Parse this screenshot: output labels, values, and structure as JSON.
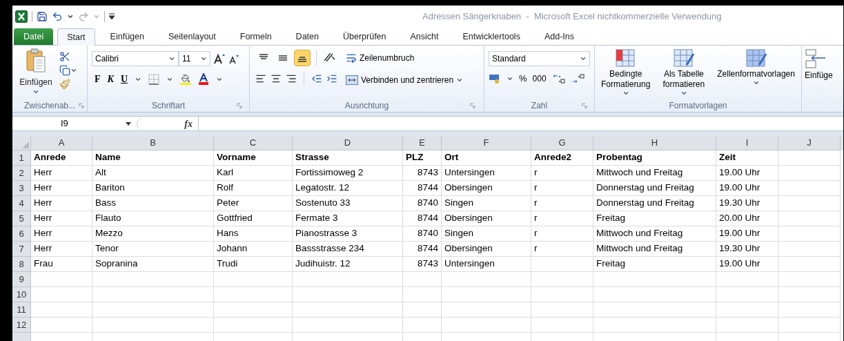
{
  "window": {
    "title": "Adressen Sängerknaben  -  Microsoft Excel nichtkommerzielle Verwendung"
  },
  "tabs": [
    {
      "label": "Datei",
      "kind": "file",
      "selected": false
    },
    {
      "label": "Start",
      "kind": "tab",
      "selected": true
    },
    {
      "label": "Einfügen",
      "kind": "tab",
      "selected": false
    },
    {
      "label": "Seitenlayout",
      "kind": "tab",
      "selected": false
    },
    {
      "label": "Formeln",
      "kind": "tab",
      "selected": false
    },
    {
      "label": "Daten",
      "kind": "tab",
      "selected": false
    },
    {
      "label": "Überprüfen",
      "kind": "tab",
      "selected": false
    },
    {
      "label": "Ansicht",
      "kind": "tab",
      "selected": false
    },
    {
      "label": "Entwicklertools",
      "kind": "tab",
      "selected": false
    },
    {
      "label": "Add-Ins",
      "kind": "tab",
      "selected": false
    }
  ],
  "ribbon": {
    "clipboard": {
      "label": "Zwischenab...",
      "paste": "Einfügen"
    },
    "font": {
      "label": "Schriftart",
      "font_name": "Calibri",
      "font_size": "11",
      "bold": "F",
      "italic": "K",
      "underline": "U"
    },
    "alignment": {
      "label": "Ausrichtung",
      "vertical": [
        {
          "selected": false
        },
        {
          "selected": false
        },
        {
          "selected": true
        }
      ],
      "wrap": "Zeilenumbruch",
      "merge": "Verbinden und zentrieren"
    },
    "number": {
      "label": "Zahl",
      "format": "Standard",
      "percent": "%",
      "thousands": "000"
    },
    "styles": {
      "label": "Formatvorlagen",
      "buttons": [
        {
          "lines": [
            "Bedingte",
            "Formatierung"
          ]
        },
        {
          "lines": [
            "Als Tabelle",
            "formatieren"
          ]
        },
        {
          "lines": [
            "Zellenformatvorlagen"
          ]
        }
      ]
    },
    "cells": {
      "insert": "Einfüge"
    }
  },
  "formula_bar": {
    "name_box": "I9",
    "function_label": "fx"
  },
  "grid": {
    "columns": [
      {
        "letter": "A",
        "kind": "text"
      },
      {
        "letter": "B",
        "kind": "text"
      },
      {
        "letter": "C",
        "kind": "text"
      },
      {
        "letter": "D",
        "kind": "text"
      },
      {
        "letter": "E",
        "kind": "number"
      },
      {
        "letter": "F",
        "kind": "text"
      },
      {
        "letter": "G",
        "kind": "text"
      },
      {
        "letter": "H",
        "kind": "text"
      },
      {
        "letter": "I",
        "kind": "text"
      },
      {
        "letter": "J",
        "kind": "text"
      }
    ],
    "header_row": {
      "number": "1",
      "cells": [
        "Anrede",
        "Name",
        "Vorname",
        "Strasse",
        "PLZ",
        "Ort",
        "Anrede2",
        "Probentag",
        "Zeit",
        null
      ]
    },
    "rows": [
      {
        "number": "2",
        "cells": [
          "Herr",
          "Alt",
          "Karl",
          "Fortissimoweg 2",
          "8743",
          "Untersingen",
          "r",
          "Mittwoch und Freitag",
          "19.00 Uhr",
          null
        ]
      },
      {
        "number": "3",
        "cells": [
          "Herr",
          "Bariton",
          "Rolf",
          "Legatostr. 12",
          "8744",
          "Obersingen",
          "r",
          "Donnerstag und Freitag",
          "19.00 Uhr",
          null
        ]
      },
      {
        "number": "4",
        "cells": [
          "Herr",
          "Bass",
          "Peter",
          "Sostenuto 33",
          "8740",
          "Singen",
          "r",
          "Donnerstag und Freitag",
          "19.30 Uhr",
          null
        ]
      },
      {
        "number": "5",
        "cells": [
          "Herr",
          "Flauto",
          "Gottfried",
          "Fermate 3",
          "8744",
          "Obersingen",
          "r",
          "Freitag",
          "20.00 Uhr",
          null
        ]
      },
      {
        "number": "6",
        "cells": [
          "Herr",
          "Mezzo",
          "Hans",
          "Pianostrasse 3",
          "8740",
          "Singen",
          "r",
          "Mittwoch und Freitag",
          "19.00 Uhr",
          null
        ]
      },
      {
        "number": "7",
        "cells": [
          "Herr",
          "Tenor",
          "Johann",
          "Bassstrasse 234",
          "8744",
          "Obersingen",
          "r",
          "Mittwoch und Freitag",
          "19.30 Uhr",
          null
        ]
      },
      {
        "number": "8",
        "cells": [
          "Frau",
          "Sopranina",
          "Trudi",
          "Judihuistr. 12",
          "8743",
          "Untersingen",
          null,
          "Freitag",
          "19.00 Uhr",
          null
        ]
      },
      {
        "number": "9"
      },
      {
        "number": "10"
      },
      {
        "number": "11"
      },
      {
        "number": "12"
      }
    ]
  }
}
